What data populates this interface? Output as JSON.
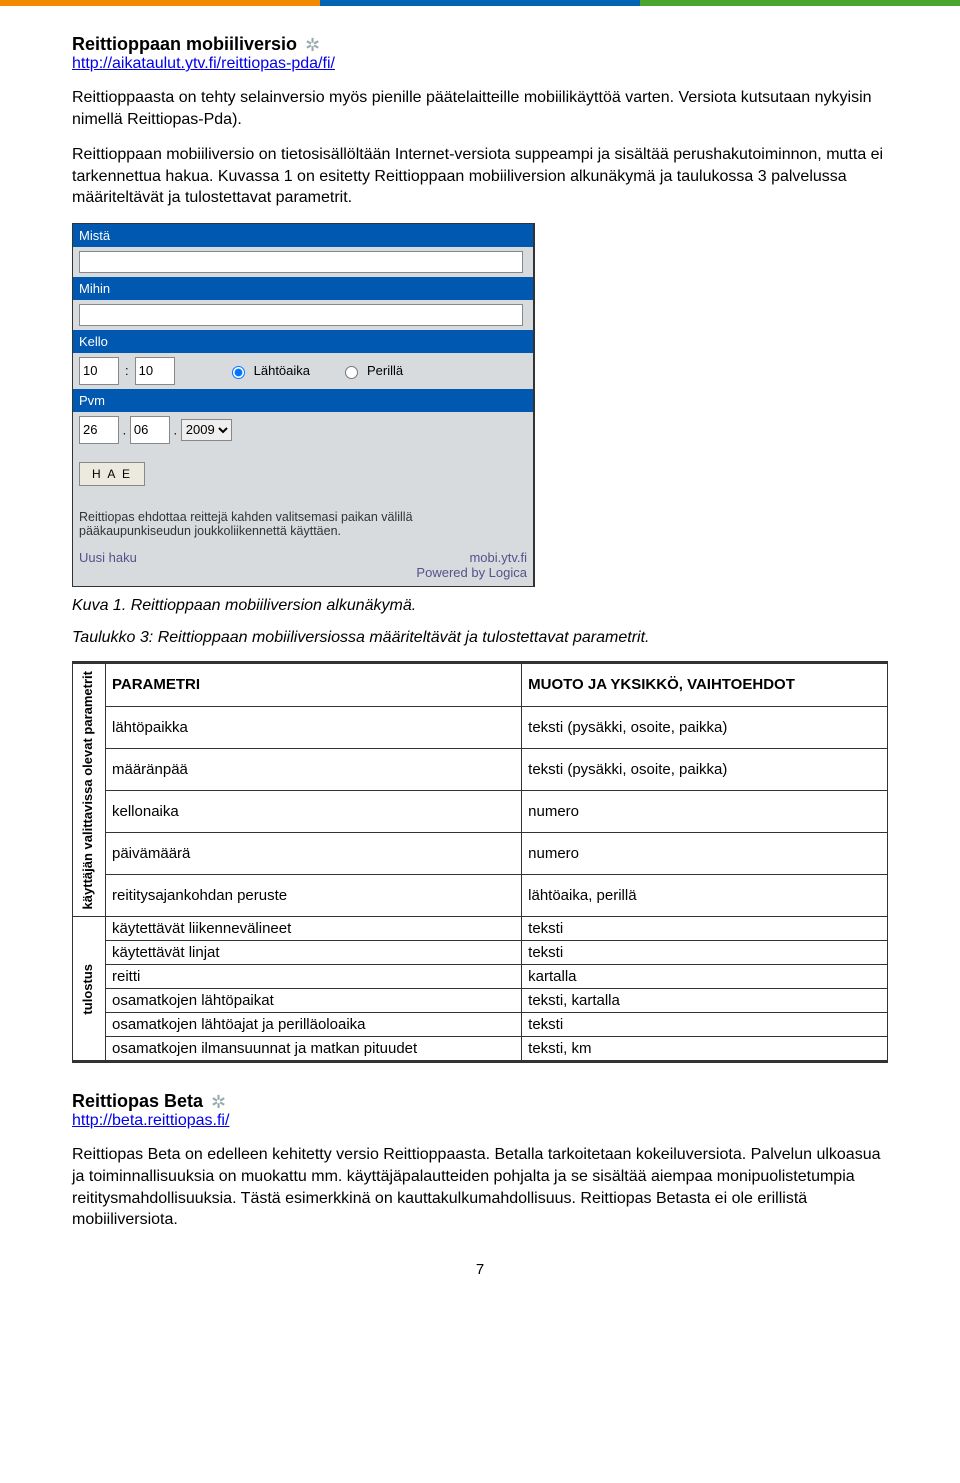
{
  "section1": {
    "title": "Reittioppaan mobiiliversio",
    "url": "http://aikataulut.ytv.fi/reittiopas-pda/fi/",
    "para1": "Reittioppaasta on tehty selainversio myös pienille päätelaitteille mobiilikäyttöä varten. Versiota kutsutaan nykyisin nimellä Reittiopas-Pda).",
    "para2": "Reittioppaan mobiiliversio on tietosisällöltään Internet-versiota suppeampi ja sisältää perushakutoiminnon, mutta ei tarkennettua hakua. Kuvassa 1 on esitetty Reittioppaan mobiiliversion alkunäkymä ja taulukossa 3 palvelussa määriteltävät ja tulostettavat parametrit."
  },
  "mobile": {
    "label_from": "Mistä",
    "label_to": "Mihin",
    "label_time": "Kello",
    "hour": "10",
    "minute": "10",
    "radio_depart": "Lähtöaika",
    "radio_arrive": "Perillä",
    "label_date": "Pvm",
    "day": "26",
    "month": "06",
    "year": "2009",
    "btn_search": "H A E",
    "footer_text": "Reittiopas ehdottaa reittejä kahden valitsemasi paikan välillä pääkaupunkiseudun joukkoliikennettä käyttäen.",
    "link_new": "Uusi haku",
    "link_mobi": "mobi.ytv.fi",
    "link_powered": "Powered by Logica"
  },
  "fig_caption": "Kuva 1. Reittioppaan mobiiliversion alkunäkymä.",
  "table_caption": "Taulukko 3: Reittioppaan mobiiliversiossa määriteltävät ja tulostettavat parametrit.",
  "table": {
    "col1_header": "PARAMETRI",
    "col2_header": "MUOTO JA YKSIKKÖ, VAIHTOEHDOT",
    "group1_label": "käyttäjän valittavissa olevat parametrit",
    "group2_label": "tulostus",
    "rows1": [
      {
        "p": "lähtöpaikka",
        "m": "teksti (pysäkki, osoite, paikka)"
      },
      {
        "p": "määränpää",
        "m": "teksti (pysäkki, osoite, paikka)"
      },
      {
        "p": "kellonaika",
        "m": "numero"
      },
      {
        "p": "päivämäärä",
        "m": "numero"
      },
      {
        "p": "reititysajankohdan peruste",
        "m": "lähtöaika, perillä"
      }
    ],
    "rows2": [
      {
        "p": "käytettävät liikennevälineet",
        "m": "teksti"
      },
      {
        "p": "käytettävät linjat",
        "m": "teksti"
      },
      {
        "p": "reitti",
        "m": "kartalla"
      },
      {
        "p": "osamatkojen lähtöpaikat",
        "m": "teksti, kartalla"
      },
      {
        "p": "osamatkojen lähtöajat ja perilläoloaika",
        "m": "teksti"
      },
      {
        "p": "osamatkojen ilmansuunnat ja matkan pituudet",
        "m": "teksti, km"
      }
    ]
  },
  "section2": {
    "title": "Reittiopas Beta",
    "url": "http://beta.reittiopas.fi/",
    "para": "Reittiopas Beta on edelleen kehitetty versio Reittioppaasta. Betalla tarkoitetaan kokeiluversiota. Palvelun ulkoasua ja toiminnallisuuksia on muokattu mm. käyttäjäpalautteiden pohjalta ja se sisältää aiempaa monipuolistetumpia reititysmahdollisuuksia. Tästä esimerkkinä on kauttakulkumahdollisuus. Reittiopas Betasta ei ole erillistä mobiiliversiota."
  },
  "page_number": "7"
}
